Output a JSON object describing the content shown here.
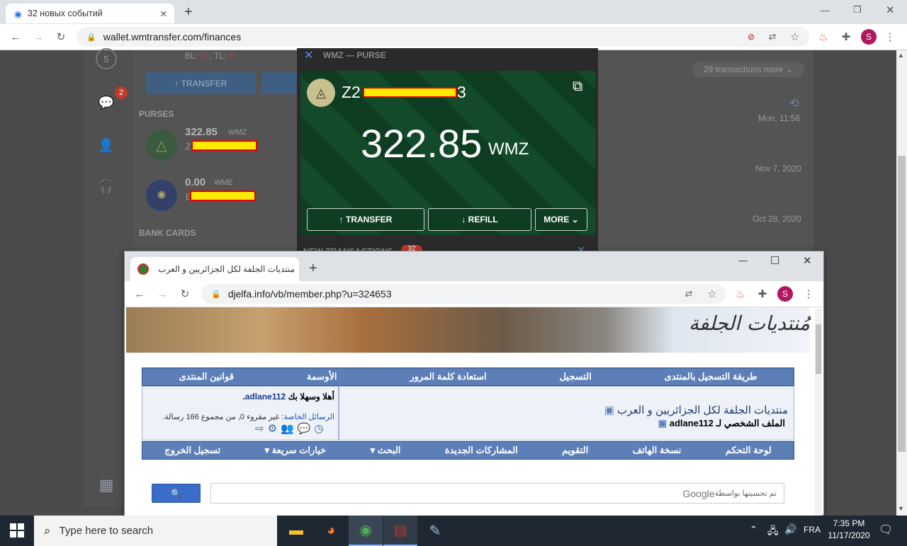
{
  "main_browser": {
    "tab_title": "32 новых событий",
    "url": "wallet.wmtransfer.com/finances",
    "new_tab": "+",
    "avatar_letter": "S",
    "window_controls": [
      "—",
      "❐",
      "✕"
    ]
  },
  "wallet": {
    "top_stats": {
      "label": "BL: ",
      "bl": "61",
      "tl_label": ", TL: ",
      "tl": "0"
    },
    "nav_badge_5": "5",
    "nav_badge_chat": "2",
    "transfer_label": "↑ TRANSFER",
    "purses_heading": "PURSES",
    "purse_list": [
      {
        "amount": "322.85",
        "currency": "WMZ",
        "prefix": "Z"
      },
      {
        "amount": "0.00",
        "currency": "WME",
        "prefix": "E"
      }
    ],
    "bank_cards_heading": "BANK CARDS",
    "transactions_more": "29 transactions more",
    "dates": [
      "Mon, 11:56",
      "Nov 7, 2020",
      "Oct 28, 2020"
    ]
  },
  "purse_modal": {
    "title": "WMZ — PURSE",
    "purse_id_start": "Z2",
    "purse_id_end": "3",
    "balance": "322.85",
    "currency": "WMZ",
    "buttons": {
      "transfer": "↑ TRANSFER",
      "refill": "↓ REFILL",
      "more": "MORE ⌄"
    },
    "new_transactions": "NEW TRANSACTIONS",
    "new_count": "32"
  },
  "second_browser": {
    "tab_title": "منتديات الجلفة لكل الجزائريين و العرب",
    "url": "djelfa.info/vb/member.php?u=324653",
    "avatar_letter": "S",
    "window_controls": [
      "—",
      "☐",
      "✕"
    ]
  },
  "forum": {
    "top_nav": [
      "طريقة التسجيل بالمنتدى",
      "التسجيل",
      "استعادة كلمة المرور",
      "الأوسمة",
      "قوانين المنتدى"
    ],
    "breadcrumb_site": "منتديات الجلفة لكل الجزائريين و العرب",
    "breadcrumb_page": "الملف الشخصي لـ adlane112",
    "welcome_prefix": "أهلا وسهلا بك ",
    "welcome_user": "adlane112",
    "welcome_suffix": ".",
    "pm_label": "الرسائل الخاصة",
    "pm_text": ": غير مقروء 0, من مجموع 166 رسالة.",
    "bottom_nav": [
      "لوحة التحكم",
      "نسخة الهاتف",
      "التقويم",
      "المشاركات الجديدة",
      "البحث ▾",
      "خيارات سريعة ▾",
      "تسجيل الخروج"
    ],
    "search_placeholder": "تم تحسينها بواسطة",
    "google": "Google",
    "search_btn": "🔍"
  },
  "taskbar": {
    "search_placeholder": "Type here to search",
    "lang": "FRA",
    "time": "7:35 PM",
    "date": "11/17/2020"
  }
}
